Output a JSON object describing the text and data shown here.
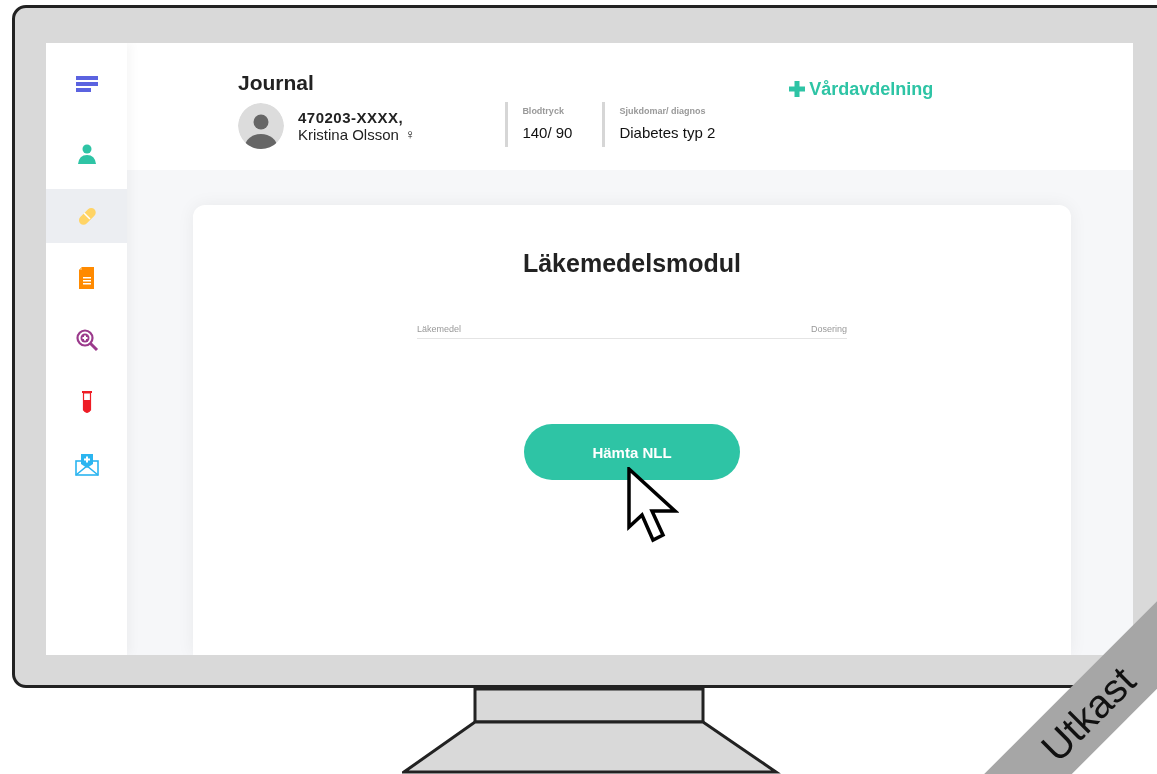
{
  "header": {
    "title": "Journal",
    "patient": {
      "id": "470203-XXXX,",
      "name": "Kristina Olsson",
      "sex_symbol": "♀"
    },
    "vitals": [
      {
        "label": "Blodtryck",
        "value": "140/ 90"
      },
      {
        "label": "Sjukdomar/ diagnos",
        "value": "Diabetes typ 2"
      }
    ],
    "ward_link": "Vårdavdelning"
  },
  "sidebar": {
    "items": [
      {
        "selected": false
      },
      {
        "selected": true
      },
      {
        "selected": false
      },
      {
        "selected": false
      },
      {
        "selected": false
      },
      {
        "selected": false
      }
    ]
  },
  "module": {
    "title": "Läkemedelsmodul",
    "columns": [
      "Läkemedel",
      "Dosering"
    ],
    "button": "Hämta NLL"
  },
  "ribbon": "Utkast"
}
